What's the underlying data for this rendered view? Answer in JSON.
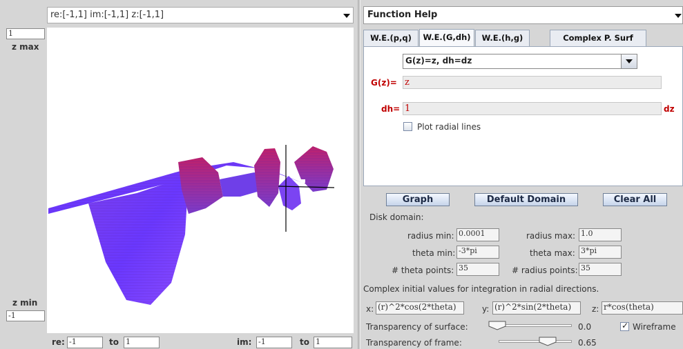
{
  "plot": {
    "range_title": "re:[-1,1] im:[-1,1] z:[-1,1]",
    "zmax_value": "1",
    "zmax_label": "z max",
    "zmin_label": "z min",
    "zmin_value": "-1",
    "re_label": "re:",
    "re_from": "-1",
    "re_to_label": "to",
    "re_to": "1",
    "im_label": "im:",
    "im_from": "-1",
    "im_to_label": "to",
    "im_to": "1"
  },
  "right": {
    "help_select": "Function Help",
    "tabs": [
      "W.E.(p,q)",
      "W.E.(G,dh)",
      "W.E.(h,g)",
      "Complex P. Surf"
    ],
    "preset_select": "G(z)=z, dh=dz",
    "g_label": "G(z)=",
    "g_value": "z",
    "dh_label": "dh=",
    "dh_value": "1",
    "dz_label": "dz",
    "radial_label": "Plot radial lines",
    "graph_button": "Graph",
    "default_domain_button": "Default Domain",
    "clear_all_button": "Clear All",
    "disk_domain_label": "Disk domain:",
    "radius_min_label": "radius min:",
    "radius_min": "0.0001",
    "radius_max_label": "radius max:",
    "radius_max": "1.0",
    "theta_min_label": "theta min:",
    "theta_min": "-3*pi",
    "theta_max_label": "theta max:",
    "theta_max": "3*pi",
    "theta_points_label": "# theta points:",
    "theta_points": "35",
    "radius_points_label": "# radius points:",
    "radius_points": "35",
    "complex_init_label": "Complex initial values for integration in radial directions.",
    "x_label": "x:",
    "x_value": "(r)^2*cos(2*theta)",
    "y_label": "y:",
    "y_value": "(r)^2*sin(2*theta)",
    "z_label": "z:",
    "z_value": "r*cos(theta)",
    "surf_transp_label": "Transparency of surface:",
    "surf_transp_value": "0.0",
    "surf_transp_level": 0.0,
    "wireframe_label": "Wireframe",
    "frame_transp_label": "Transparency of frame:",
    "frame_transp_value": "0.65",
    "frame_transp_level": 0.65
  },
  "colors": {
    "surface_light": "#8a4cff",
    "surface_dark": "#c0206a",
    "accent_red": "#c00000"
  }
}
